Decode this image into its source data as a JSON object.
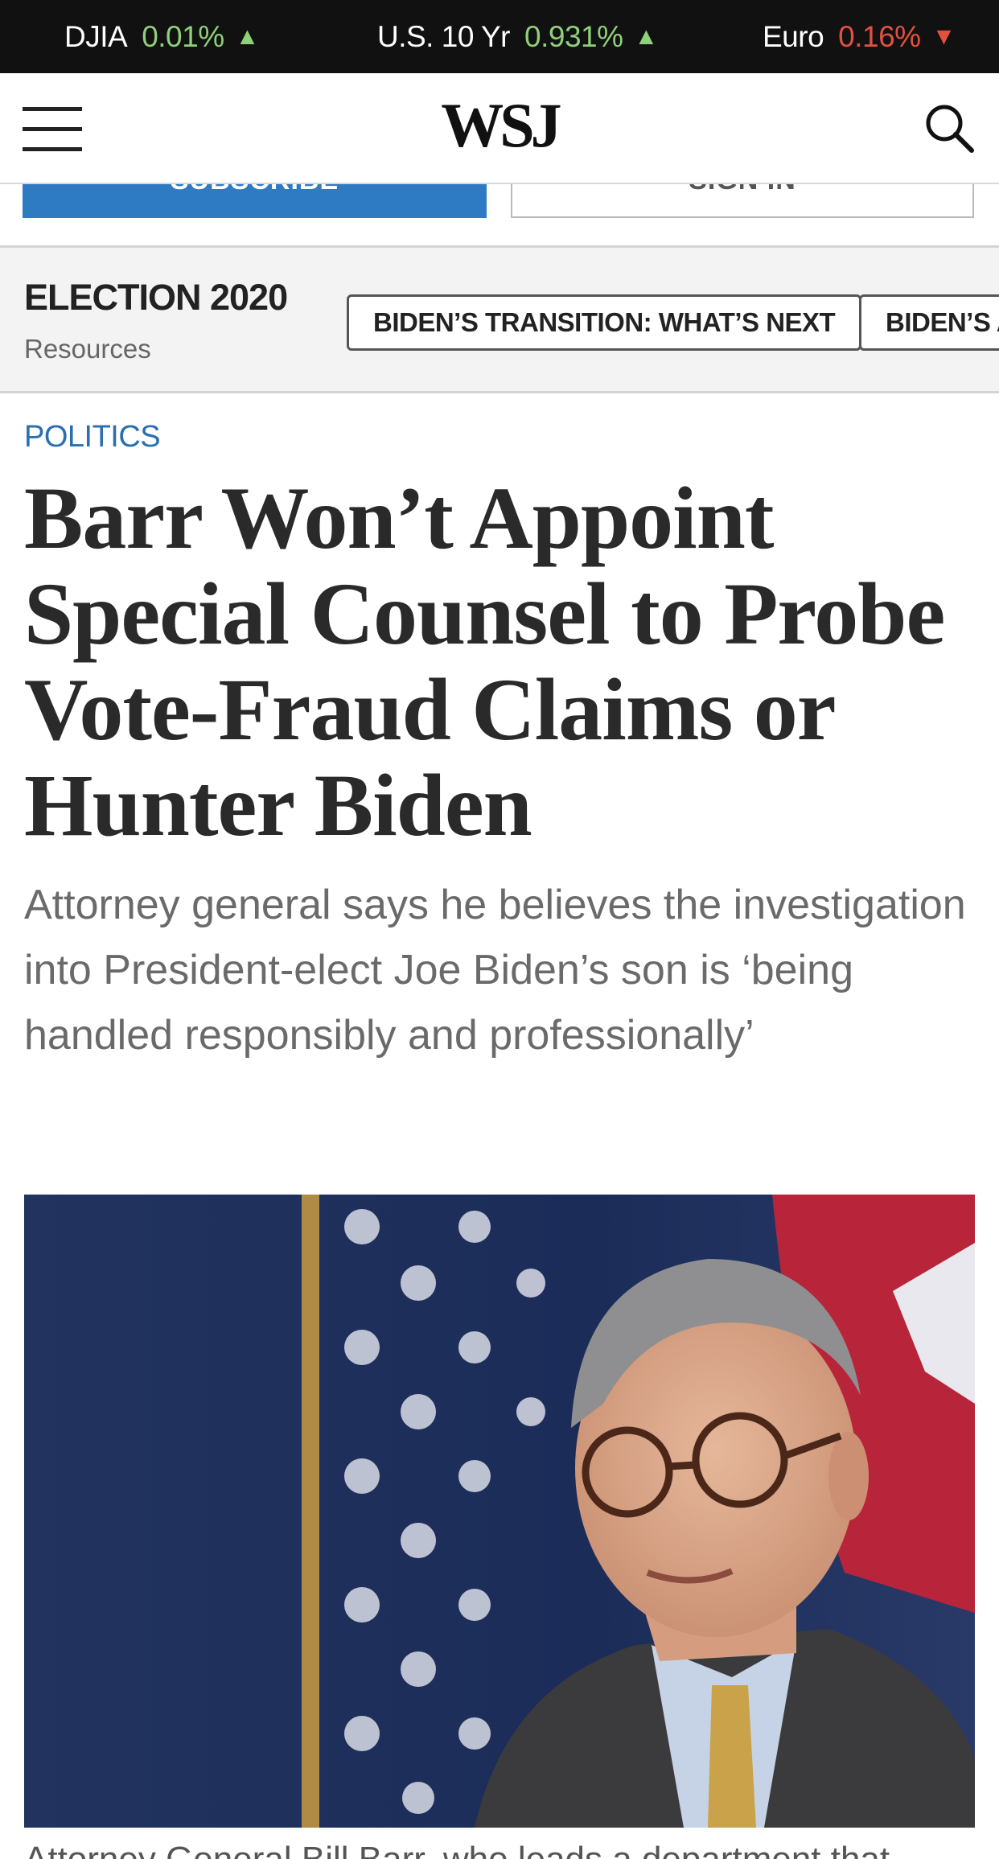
{
  "ticker": [
    {
      "name": "DJIA",
      "value": "0.01%",
      "direction": "up"
    },
    {
      "name": "U.S. 10 Yr",
      "value": "0.931%",
      "direction": "up"
    },
    {
      "name": "Euro",
      "value": "0.16%",
      "direction": "down"
    }
  ],
  "header": {
    "logo": "WSJ",
    "menu_icon": "hamburger-menu-icon",
    "search_icon": "search-icon"
  },
  "auth": {
    "subscribe_label": "SUBSCRIBE",
    "signin_label": "SIGN IN"
  },
  "election": {
    "title": "ELECTION 2020",
    "subtitle": "Resources",
    "links": [
      "BIDEN’S TRANSITION: WHAT’S NEXT",
      "BIDEN’S ADMINISTRATION"
    ]
  },
  "article": {
    "category": "POLITICS",
    "headline": "Barr Won’t Appoint Special Counsel to Probe Vote-Fraud Claims or Hunter Biden",
    "dek": "Attorney general says he believes the investigation into President-elect Joe Biden’s son is ‘being handled responsibly and professionally’",
    "caption": "Attorney General Bill Barr, who leads a department that"
  },
  "colors": {
    "up": "#8fd07a",
    "down": "#e2513f",
    "accent": "#2a6fb0",
    "subscribe": "#2e7bc4"
  }
}
